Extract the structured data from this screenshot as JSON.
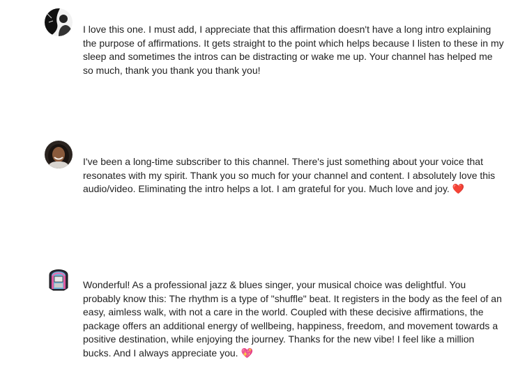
{
  "comments": [
    {
      "avatar_icon": "user-avatar-bw-icon",
      "text": "I love this one. I must add, I appreciate that this affirmation doesn't have a long intro explaining the purpose of affirmations. It gets straight to the point which helps because I listen to these in my sleep and sometimes the intros can be distracting or wake me up. Your channel has helped me so much, thank you thank you thank you!"
    },
    {
      "avatar_icon": "user-avatar-photo-icon",
      "text": "I've been a long-time subscriber to this channel. There's just something about your voice that resonates with my spirit. Thank you so much for your channel and content. I absolutely love this audio/video. Eliminating the intro helps a lot. I am grateful for you. Much love and joy. ❤️"
    },
    {
      "avatar_icon": "jukebox-avatar-icon",
      "text": "Wonderful! As a professional jazz & blues singer, your musical choice was delightful. You probably know this: The rhythm is a type of \"shuffle\" beat. It registers in the body as the feel of an easy, aimless walk, with not a care in the world. Coupled with these  decisive  affirmations, the package offers an additional energy of wellbeing, happiness, freedom, and movement towards a positive destination, while enjoying the journey. Thanks for the new vibe! I feel like a million bucks. And I always appreciate you.  💖"
    }
  ],
  "colors": {
    "text": "#1f1f1f",
    "background": "#ffffff"
  }
}
